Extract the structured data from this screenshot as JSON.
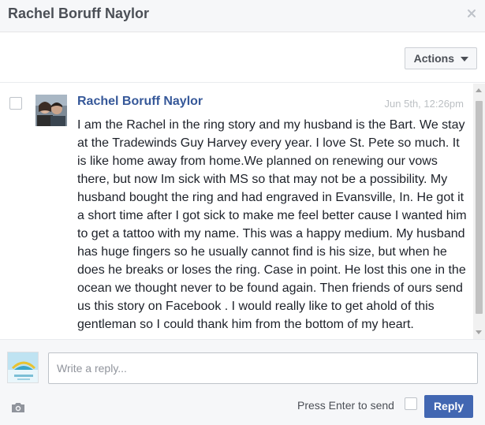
{
  "header": {
    "title": "Rachel Boruff Naylor",
    "close_icon": "close-icon"
  },
  "toolbar": {
    "actions_label": "Actions",
    "actions_icon": "caret-down-icon"
  },
  "message": {
    "sender": "Rachel Boruff Naylor",
    "timestamp": "Jun 5th, 12:26pm",
    "body": "I am the Rachel in the ring story and my husband is the Bart. We stay at the Tradewinds Guy Harvey every year. I love St. Pete so much. It is like home away from home.We planned on renewing our vows there, but now Im sick with MS so that may not be a possibility. My husband bought the ring and had engraved in Evansville, In. He got it a short time after I got sick to make me feel better cause I wanted him to get a tattoo with my name. This was a happy medium. My husband has huge fingers so he usually cannot find is his size, but when he does he breaks or loses the ring. Case in point. He lost this one in the ocean we thought never to be found again. Then friends of ours send us this story on Facebook . I would really like to get ahold of this gentleman so I could thank him from the bottom of my heart.",
    "selected": false
  },
  "composer": {
    "placeholder": "Write a reply...",
    "value": "",
    "enter_to_send_label": "Press Enter to send",
    "enter_to_send_checked": false,
    "reply_label": "Reply",
    "camera_icon": "camera-icon"
  },
  "colors": {
    "header_bg": "#f6f7f9",
    "sender_link": "#365899",
    "timestamp": "#bcc0c4",
    "reply_button": "#4267b2",
    "text": "#1d2129"
  }
}
